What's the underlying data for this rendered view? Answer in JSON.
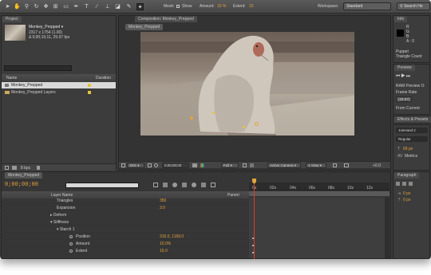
{
  "toolbar": {
    "mesh_label": "Mesh:",
    "show_label": "Show",
    "amount_label": "Amount:",
    "amount_value": "15 %",
    "extent_label": "Extent:",
    "extent_value": "15",
    "workspace_label": "Workspace:",
    "workspace_value": "Standard",
    "search_placeholder": "Search He"
  },
  "project": {
    "tab": "Project",
    "item_name": "Monkey_Prepped ▾",
    "item_size": "2317 x 1754 (1.00)",
    "item_duration": "Δ 0;00;15;11, 29.97 fps",
    "col_name": "Name",
    "col_duration": "Duration",
    "rows": [
      "Monkey_Prepped",
      "Monkey_Prepped Layers"
    ],
    "bpc": "8 bpc"
  },
  "composition": {
    "tab": "Composition: Monkey_Prepped",
    "sub_tab": "Monkey_Prepped",
    "zoom": "25%",
    "timecode": "0;00;00;00",
    "resolution": "Full",
    "camera": "Active Camera",
    "view": "1 View",
    "offset": "+0.0"
  },
  "info": {
    "tab": "Info",
    "r": "R",
    "g": "G",
    "b": "B",
    "a": "A : 0",
    "line1": "Puppet",
    "line2": "Triangle Count"
  },
  "preview": {
    "tab": "Preview",
    "ram_options": "RAM Preview O",
    "frame_rate": "Frame Rate",
    "fps_value": "(29.97)",
    "from_current": "From Current"
  },
  "effects": {
    "tab": "Effects & Presets"
  },
  "character": {
    "font": "JoeHand 2",
    "style": "Regular",
    "size": "69 px",
    "tracking": "Metrics"
  },
  "paragraph": {
    "tab": "Paragraph",
    "indent1": "0 px",
    "indent2": "0 px"
  },
  "timeline": {
    "tab": "Monkey_Prepped",
    "timecode": "0;00;00;00",
    "col_layer": "Layer Name",
    "col_parent": "Parent",
    "ticks": [
      "0s",
      "02s",
      "04s",
      "06s",
      "08s",
      "10s",
      "12s"
    ],
    "rows": [
      {
        "name": "Triangles",
        "value": "350"
      },
      {
        "name": "Expansion",
        "value": "3.0"
      },
      {
        "name": "▸  Deform",
        "value": ""
      },
      {
        "name": "▾  Stiffness",
        "value": ""
      },
      {
        "name": "▾  Starch 1",
        "value": ""
      },
      {
        "name": "Position",
        "value": "316.0, 1169.0"
      },
      {
        "name": "Amount",
        "value": "10.0%"
      },
      {
        "name": "Extent",
        "value": "15.0"
      }
    ]
  },
  "accent": "#e4a33c"
}
